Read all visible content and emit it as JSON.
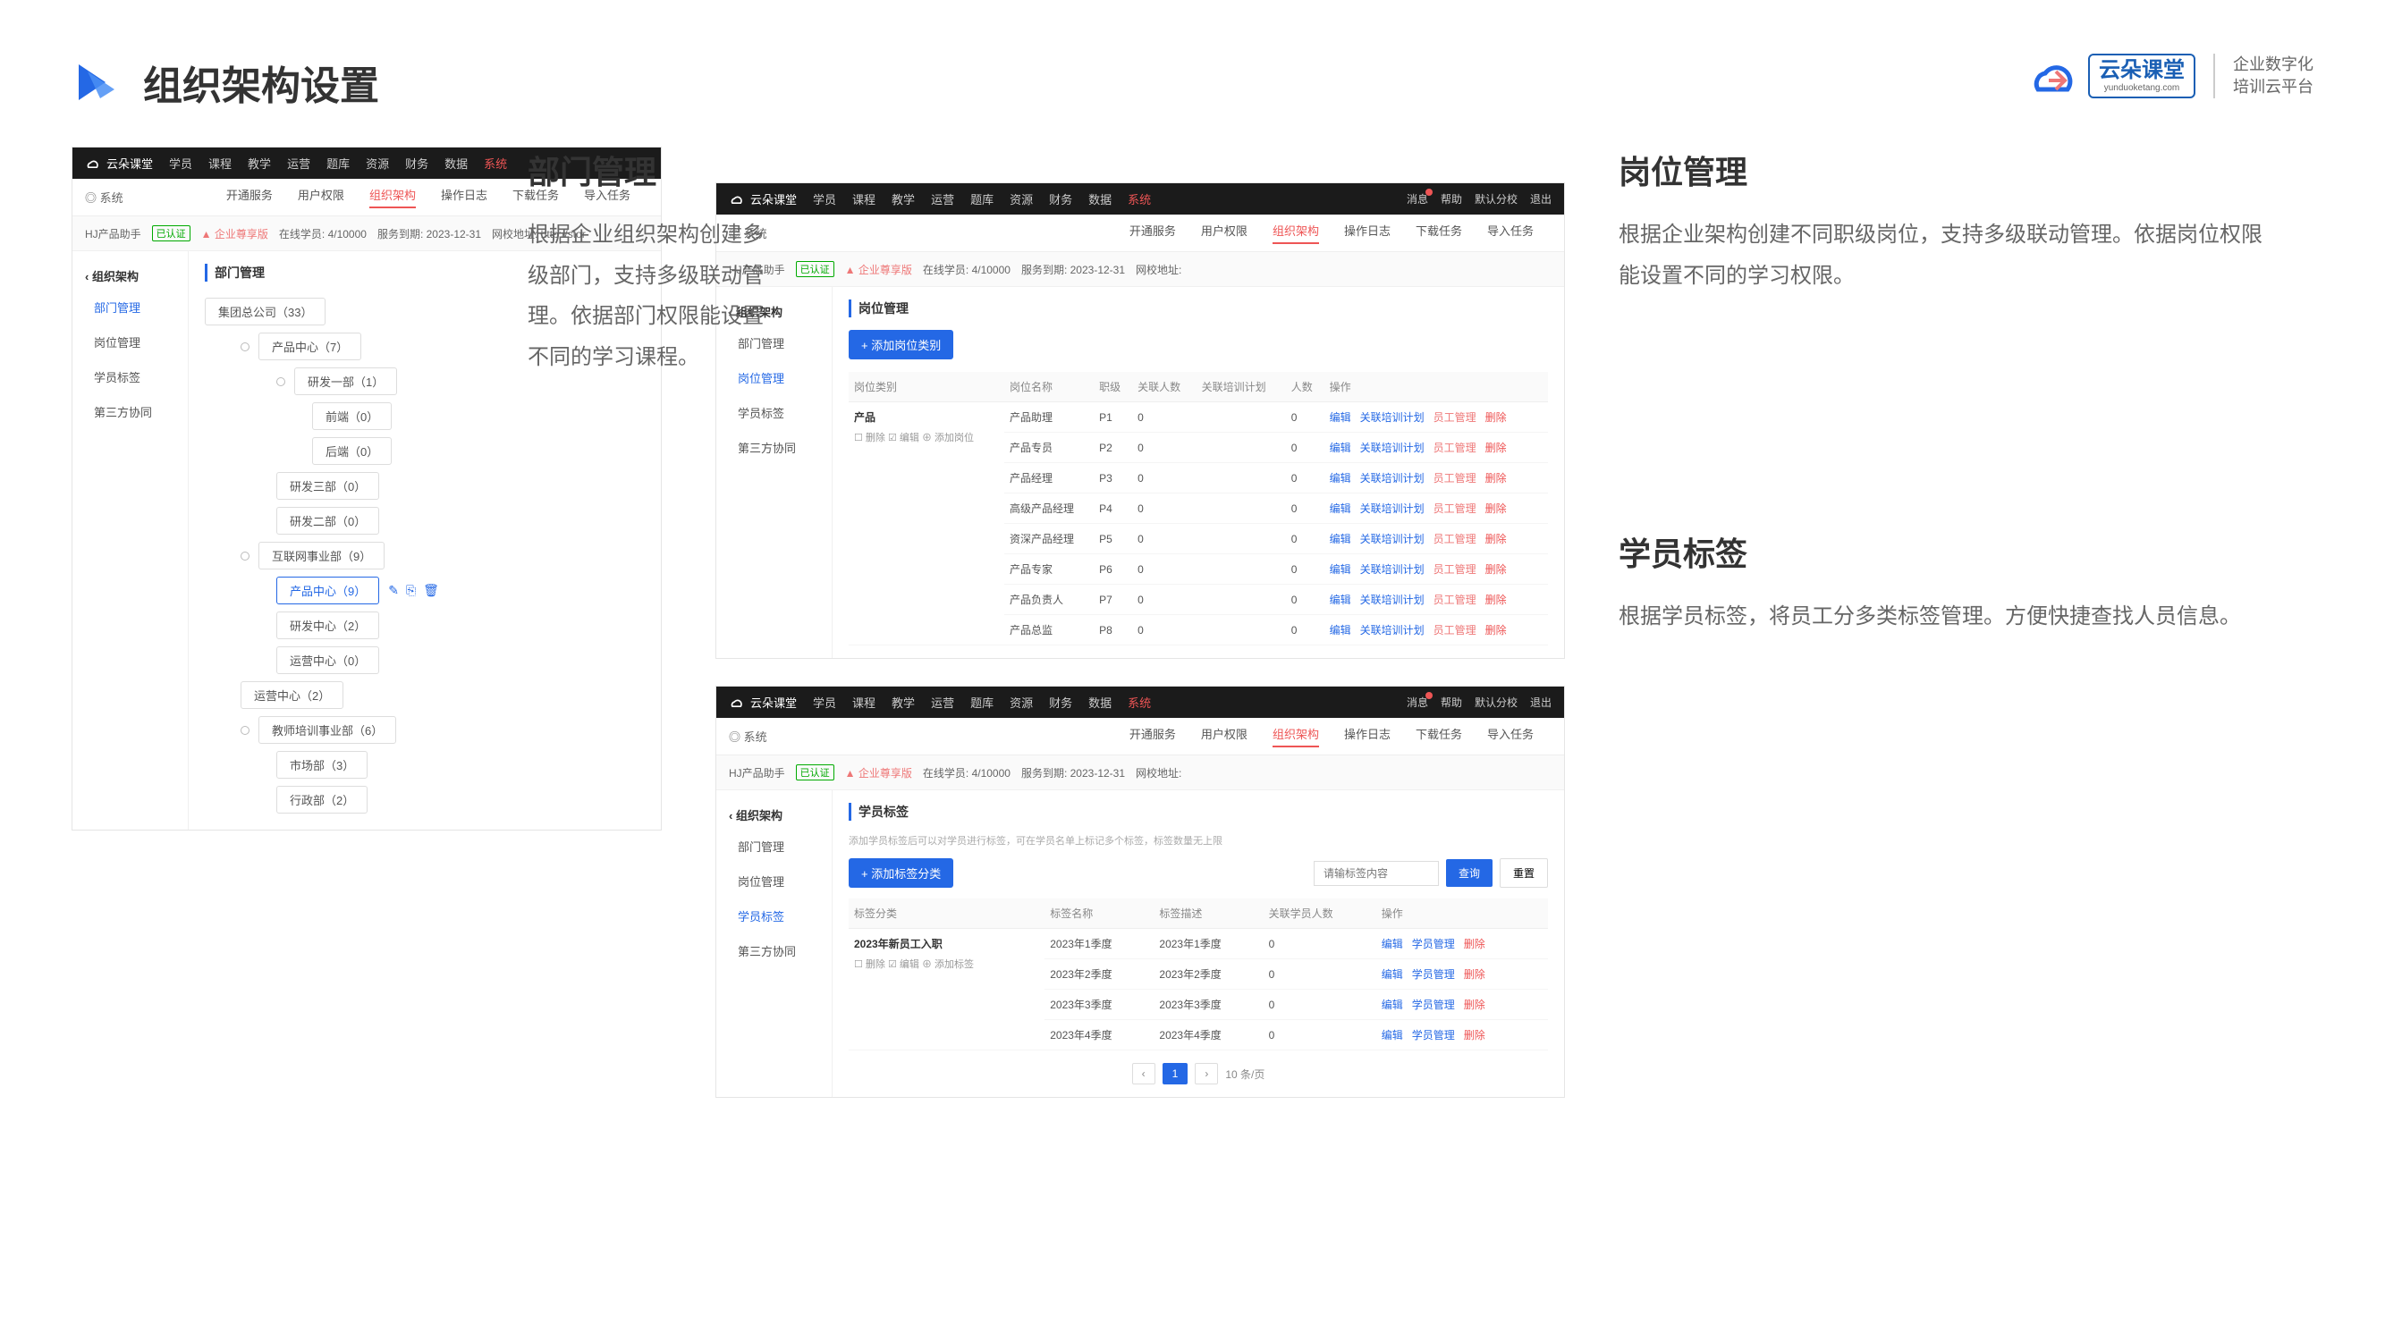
{
  "page": {
    "title": "组织架构设置",
    "brand_cn": "云朵课堂",
    "brand_en": "yunduoketang.com",
    "brand_tagline1": "企业数字化",
    "brand_tagline2": "培训云平台"
  },
  "topnav": {
    "logo": "云朵课堂",
    "items": [
      "学员",
      "课程",
      "教学",
      "运营",
      "题库",
      "资源",
      "财务",
      "数据"
    ],
    "hl": "系统",
    "right": [
      "消息",
      "帮助",
      "默认分校",
      "退出"
    ]
  },
  "subnav": {
    "left": "◎ 系统",
    "items": [
      "开通服务",
      "用户权限",
      "组织架构",
      "操作日志",
      "下载任务",
      "导入任务"
    ],
    "active": "组织架构"
  },
  "infobar": {
    "prod": "HJ产品助手",
    "cert": "已认证",
    "plan": "企业尊享版",
    "online": "在线学员: 4/10000",
    "expire": "服务到期: 2023-12-31",
    "domain": "网校地址: http://stor"
  },
  "sidebar": {
    "title": "组织架构",
    "items": [
      "部门管理",
      "岗位管理",
      "学员标签",
      "第三方协同"
    ]
  },
  "shot1": {
    "title": "部门管理",
    "text_title": "部门管理",
    "text_desc": "根据企业组织架构创建多级部门，支持多级联动管理。依据部门权限能设置不同的学习课程。",
    "tree": [
      {
        "lvl": 1,
        "label": "集团总公司（33）"
      },
      {
        "lvl": 2,
        "label": "产品中心（7）",
        "dot": true
      },
      {
        "lvl": 3,
        "label": "研发一部（1）",
        "dot": true
      },
      {
        "lvl": 4,
        "label": "前端（0）"
      },
      {
        "lvl": 4,
        "label": "后端（0）"
      },
      {
        "lvl": 3,
        "label": "研发三部（0）"
      },
      {
        "lvl": 3,
        "label": "研发二部（0）"
      },
      {
        "lvl": 2,
        "label": "互联网事业部（9）",
        "dot": true
      },
      {
        "lvl": 3,
        "label": "产品中心（9）",
        "sel": true,
        "icons": true
      },
      {
        "lvl": 3,
        "label": "研发中心（2）"
      },
      {
        "lvl": 3,
        "label": "运营中心（0）"
      },
      {
        "lvl": 2,
        "label": "运营中心（2）"
      },
      {
        "lvl": 2,
        "label": "教师培训事业部（6）",
        "dot": true
      },
      {
        "lvl": 3,
        "label": "市场部（3）"
      },
      {
        "lvl": 3,
        "label": "行政部（2）"
      }
    ]
  },
  "shot2": {
    "title": "岗位管理",
    "text_title": "岗位管理",
    "text_desc": "根据企业架构创建不同职级岗位，支持多级联动管理。依据岗位权限能设置不同的学习权限。",
    "btn": "+ 添加岗位类别",
    "cols": [
      "岗位类别",
      "岗位名称",
      "职级",
      "关联人数",
      "关联培训计划",
      "人数",
      "操作"
    ],
    "cat": "产品",
    "cat_acts": "☐ 删除  ☑ 编辑  ⊕ 添加岗位",
    "rows": [
      {
        "name": "产品助理",
        "lvl": "P1",
        "a": "0",
        "b": "0"
      },
      {
        "name": "产品专员",
        "lvl": "P2",
        "a": "0",
        "b": "0"
      },
      {
        "name": "产品经理",
        "lvl": "P3",
        "a": "0",
        "b": "0"
      },
      {
        "name": "高级产品经理",
        "lvl": "P4",
        "a": "0",
        "b": "0"
      },
      {
        "name": "资深产品经理",
        "lvl": "P5",
        "a": "0",
        "b": "0"
      },
      {
        "name": "产品专家",
        "lvl": "P6",
        "a": "0",
        "b": "0"
      },
      {
        "name": "产品负责人",
        "lvl": "P7",
        "a": "0",
        "b": "0"
      },
      {
        "name": "产品总监",
        "lvl": "P8",
        "a": "0",
        "b": "0"
      }
    ],
    "ops": [
      "编辑",
      "关联培训计划",
      "员工管理",
      "删除"
    ]
  },
  "shot3": {
    "title": "学员标签",
    "text_title": "学员标签",
    "text_desc": "根据学员标签，将员工分多类标签管理。方便快捷查找人员信息。",
    "hint": "添加学员标签后可以对学员进行标签，可在学员名单上标记多个标签，标签数量无上限",
    "btn": "+ 添加标签分类",
    "search_ph": "请输标签内容",
    "search_btn": "查询",
    "reset_btn": "重置",
    "cols": [
      "标签分类",
      "标签名称",
      "标签描述",
      "关联学员人数",
      "操作"
    ],
    "cat": "2023年新员工入职",
    "cat_acts": "☐ 删除  ☑ 编辑  ⊕ 添加标签",
    "rows": [
      {
        "name": "2023年1季度",
        "desc": "2023年1季度",
        "n": "0"
      },
      {
        "name": "2023年2季度",
        "desc": "2023年2季度",
        "n": "0"
      },
      {
        "name": "2023年3季度",
        "desc": "2023年3季度",
        "n": "0"
      },
      {
        "name": "2023年4季度",
        "desc": "2023年4季度",
        "n": "0"
      }
    ],
    "ops": [
      "编辑",
      "学员管理",
      "删除"
    ],
    "pager": {
      "prev": "‹",
      "cur": "1",
      "next": "›",
      "size": "10 条/页"
    }
  }
}
